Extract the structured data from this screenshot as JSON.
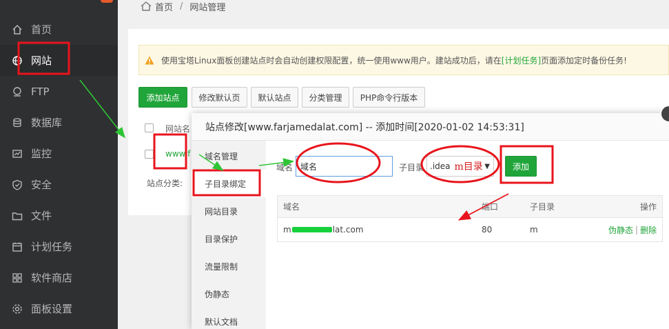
{
  "sidebar": {
    "items": [
      {
        "label": "首页",
        "icon": "home-icon"
      },
      {
        "label": "网站",
        "icon": "globe-icon"
      },
      {
        "label": "FTP",
        "icon": "ftp-icon"
      },
      {
        "label": "数据库",
        "icon": "database-icon"
      },
      {
        "label": "监控",
        "icon": "monitor-icon"
      },
      {
        "label": "安全",
        "icon": "shield-icon"
      },
      {
        "label": "文件",
        "icon": "folder-icon"
      },
      {
        "label": "计划任务",
        "icon": "calendar-icon"
      },
      {
        "label": "软件商店",
        "icon": "apps-icon"
      },
      {
        "label": "面板设置",
        "icon": "gear-icon"
      }
    ]
  },
  "breadcrumb": {
    "home": "首页",
    "separator": "/",
    "current": "网站管理"
  },
  "notice": {
    "prefix": "使用宝塔Linux面板创建站点时会自动创建权限配置，统一使用www用户。建站成功后，请在",
    "link": "[计划任务]",
    "suffix": "页面添加定时备份任务!"
  },
  "toolbar": {
    "add_site": "添加站点",
    "modify_default_page": "修改默认页",
    "default_site": "默认站点",
    "category_manage": "分类管理",
    "php_cli": "PHP命令行版本"
  },
  "site_table": {
    "header_name": "网站名",
    "row_name": "www.f",
    "category_label": "站点分类:"
  },
  "modal": {
    "title": "站点修改[www.farjamedalat.com] -- 添加时间[2020-01-02 14:53:31]",
    "nav": [
      "域名管理",
      "子目录绑定",
      "网站目录",
      "目录保护",
      "流量限制",
      "伪静态",
      "默认文档"
    ],
    "form": {
      "domain_label": "域名",
      "domain_value": "域名",
      "subdir_label": "子目录",
      "subdir_value": ".idea",
      "subdir_overlay": "m目录",
      "add_button": "添加"
    },
    "table": {
      "headers": {
        "domain": "域名",
        "port": "端口",
        "subdir": "子目录",
        "action": "操作"
      },
      "row": {
        "domain_start": "m",
        "domain_mid": "lat",
        "domain_end": ".com",
        "port": "80",
        "subdir": "m",
        "rewrite": "伪静态",
        "sep": "|",
        "delete": "删除"
      }
    }
  },
  "colors": {
    "accent_green": "#20a53a",
    "annotation_red": "#e8141c",
    "annotation_green": "#2fc436"
  }
}
